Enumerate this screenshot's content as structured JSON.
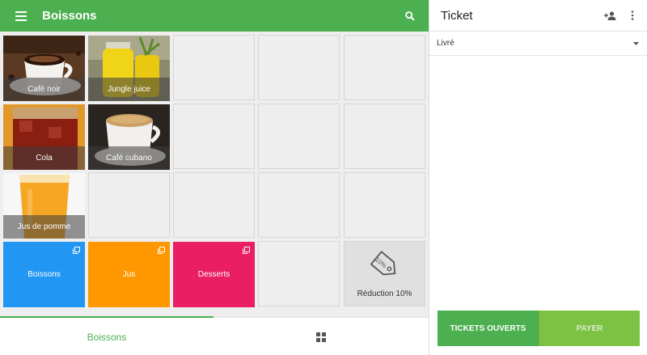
{
  "header": {
    "title": "Boissons"
  },
  "items": [
    {
      "label": "Café noir"
    },
    {
      "label": "Jungle juice"
    },
    {
      "label": "Cola"
    },
    {
      "label": "Café cubano"
    },
    {
      "label": "Jus de pomme"
    }
  ],
  "categories": [
    {
      "label": "Boissons",
      "color": "#2196f3"
    },
    {
      "label": "Jus",
      "color": "#ff9800"
    },
    {
      "label": "Desserts",
      "color": "#e91e63"
    }
  ],
  "discount": {
    "label": "Réduction 10%",
    "tag_text": "10%"
  },
  "bottom_nav": {
    "category_label": "Boissons"
  },
  "ticket": {
    "title": "Ticket",
    "dining_option": "Livré",
    "open_tickets_label": "TICKETS OUVERTS",
    "pay_label": "PAYER"
  },
  "colors": {
    "primary": "#4caf50",
    "pay": "#7dc242"
  }
}
